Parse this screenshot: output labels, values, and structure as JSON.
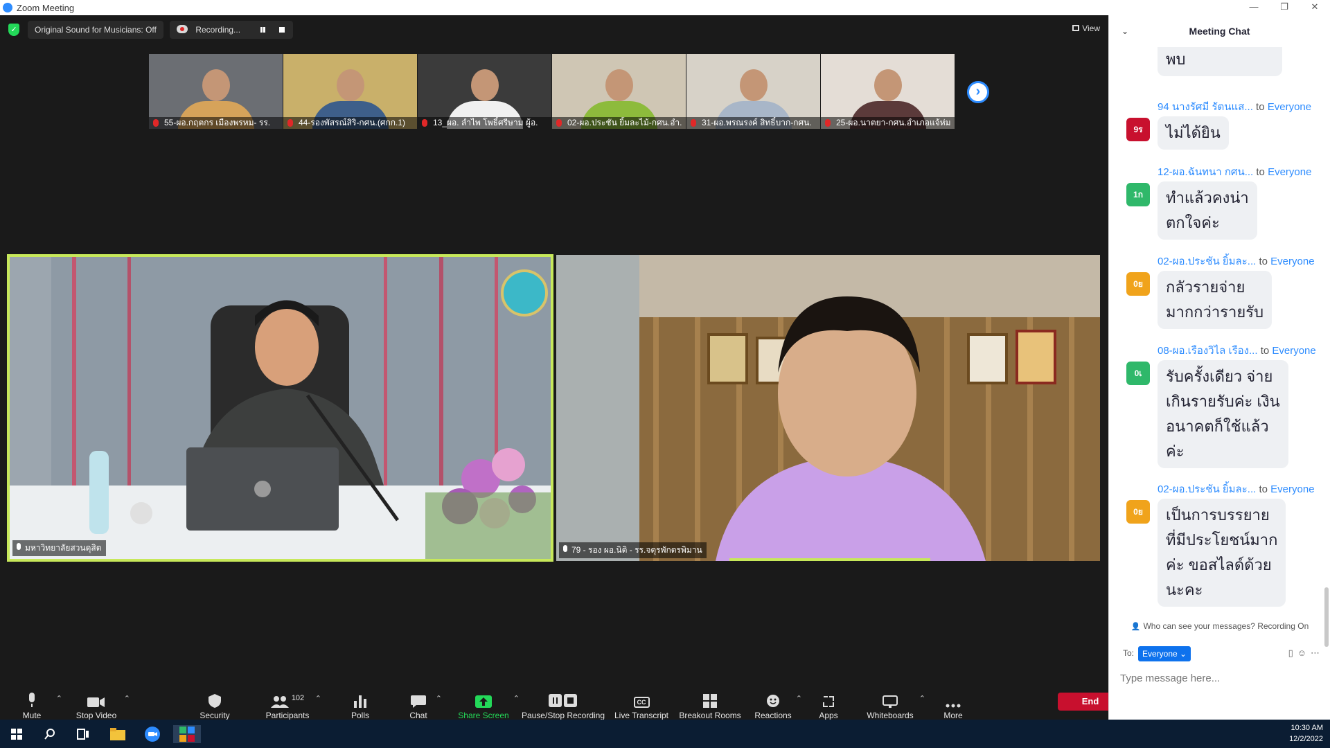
{
  "window": {
    "title": "Zoom Meeting",
    "controls": [
      "—",
      "❐",
      "✕"
    ]
  },
  "topbar": {
    "original_sound": "Original Sound for Musicians: Off",
    "recording": "Recording...",
    "view": "View"
  },
  "thumbnails": [
    {
      "name": "55-ผอ.กฤตกร เมืองพรหม- รร.",
      "bg": "#6b6e73",
      "shirt": "#d6a35a"
    },
    {
      "name": "44-รองพัสรณ์สิริ-กศน.(ศกก.1)",
      "bg": "#c9b06a",
      "shirt": "#3e5f8a"
    },
    {
      "name": "13_ผอ. ลำไพ โพธิ์ศรีษาม ผู้อ.",
      "bg": "#3b3b3b",
      "shirt": "#f0f0f0"
    },
    {
      "name": "02-ผอ.ประชัน ยิ้มละไม้-กศน.อำ.",
      "bg": "#cfc6b4",
      "shirt": "#8dbb3c"
    },
    {
      "name": "31-ผอ.พรณรงค์ สิทธิ์บาก-กศน.",
      "bg": "#d7d2c8",
      "shirt": "#a8b6c8"
    },
    {
      "name": "25-ผอ.นาตยา-กศน.อำเภอแจ้ห่ม",
      "bg": "#e4ddd6",
      "shirt": "#5b3a3a"
    }
  ],
  "next_arrow": "›",
  "main_tiles": {
    "left": {
      "name": "มหาวิทยาลัยสวนดุสิต"
    },
    "right": {
      "name": "79 - รอง ผอ.นิติ - รร.จตุรพักตรพิมาน"
    }
  },
  "toolbar": {
    "mute": "Mute",
    "stop_video": "Stop Video",
    "security": "Security",
    "participants": "Participants",
    "participant_count": "102",
    "polls": "Polls",
    "chat": "Chat",
    "share_screen": "Share Screen",
    "pause_stop": "Pause/Stop Recording",
    "live_transcript": "Live Transcript",
    "breakout": "Breakout Rooms",
    "reactions": "Reactions",
    "apps": "Apps",
    "whiteboards": "Whiteboards",
    "more": "More",
    "end": "End",
    "cc": "CC"
  },
  "chat": {
    "title": "Meeting Chat",
    "partial_text": "พบ",
    "messages": [
      {
        "avatar": "9ร",
        "color": "#c8102e",
        "sender": "94 นางรัศมี รัตนแส...",
        "to": "to",
        "target": "Everyone",
        "lines": [
          "ไม่ได้ยิน"
        ]
      },
      {
        "avatar": "1ก",
        "color": "#2fb86a",
        "sender": "12-ผอ.ฉันทนา กศน...",
        "to": "to",
        "target": "Everyone",
        "lines": [
          "ทำแล้วคงน่า",
          "ตกใจค่ะ"
        ]
      },
      {
        "avatar": "0ย",
        "color": "#f0a31b",
        "sender": "02-ผอ.ประชัน ยิ้มละ...",
        "to": "to",
        "target": "Everyone",
        "lines": [
          "กลัวรายจ่าย",
          "มากกว่ารายรับ"
        ]
      },
      {
        "avatar": "0เ",
        "color": "#2fb86a",
        "sender": "08-ผอ.เรืองวิไล เรือง...",
        "to": "to",
        "target": "Everyone",
        "lines": [
          "รับครั้งเดียว จ่าย",
          "เกินรายรับค่ะ เงิน",
          "อนาคตก็ใช้แล้ว",
          "ค่ะ"
        ]
      },
      {
        "avatar": "0ย",
        "color": "#f0a31b",
        "sender": "02-ผอ.ประชัน ยิ้มละ...",
        "to": "to",
        "target": "Everyone",
        "lines": [
          "เป็นการบรรยาย",
          "ที่มีประโยชน์มาก",
          "ค่ะ ขอสไลด์ด้วย",
          "นะคะ"
        ]
      }
    ],
    "privacy": "Who can see your messages? Recording On",
    "to_label": "To:",
    "to_target": "Everyone ⌄",
    "placeholder": "Type message here..."
  },
  "taskbar": {
    "time": "10:30 AM",
    "date": "12/2/2022"
  }
}
